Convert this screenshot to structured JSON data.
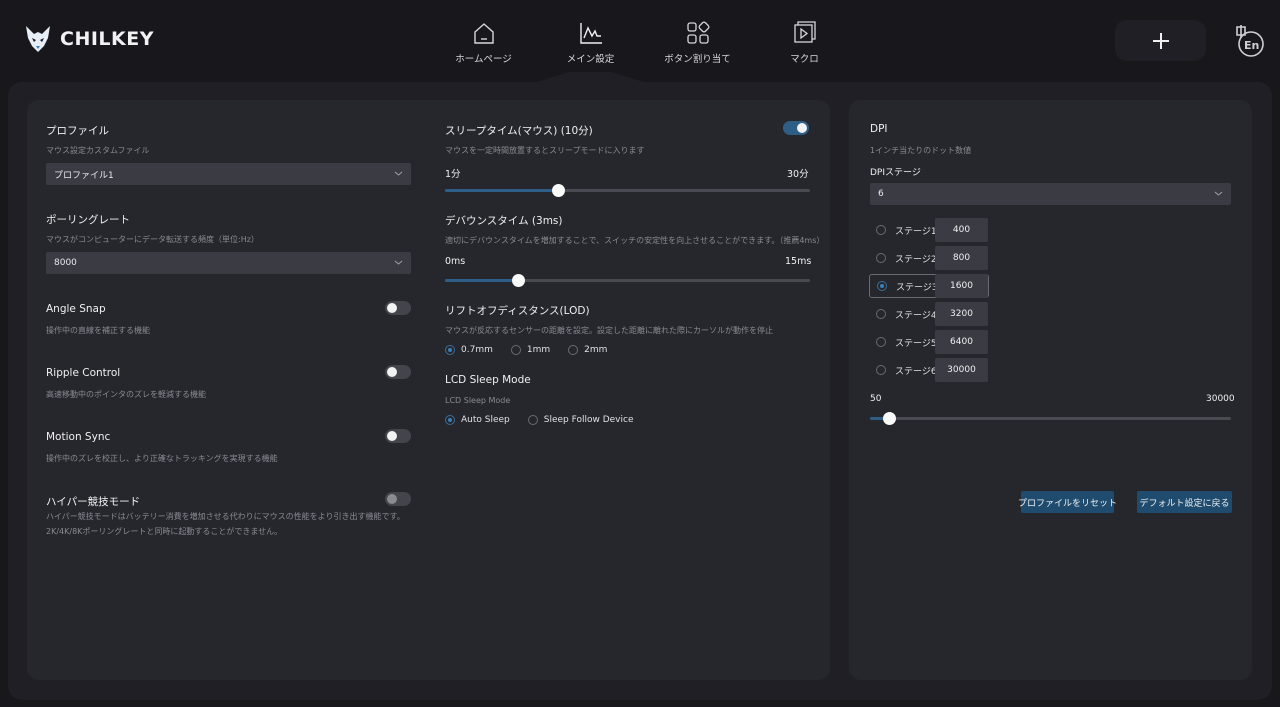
{
  "app": {
    "brand": "CHILKEY"
  },
  "nav": [
    {
      "label": "ホームページ",
      "icon": "home-icon"
    },
    {
      "label": "メイン設定",
      "icon": "chart-line-icon",
      "active": true
    },
    {
      "label": "ボタン割り当て",
      "icon": "grid-icon"
    },
    {
      "label": "マクロ",
      "icon": "macro-play-icon"
    }
  ],
  "header": {
    "add_icon": "plus-icon",
    "language_icon": "language-zh-en-icon"
  },
  "left": {
    "profile": {
      "title": "プロファイル",
      "subtitle": "マウス設定カスタムファイル",
      "value": "プロファイル1"
    },
    "polling": {
      "title": "ポーリングレート",
      "subtitle": "マウスがコンピューターにデータ転送する頻度（単位:Hz）",
      "value": "8000"
    },
    "angle_snap": {
      "title": "Angle Snap",
      "subtitle": "操作中の直線を補正する機能",
      "on": false
    },
    "ripple": {
      "title": "Ripple Control",
      "subtitle": "高速移動中のポインタのズレを軽減する機能",
      "on": false
    },
    "motion_sync": {
      "title": "Motion Sync",
      "subtitle": "操作中のズレを校正し、より正確なトラッキングを実現する機能",
      "on": false
    },
    "hyper": {
      "title": "ハイパー競技モード",
      "subtitle1": "ハイパー競技モードはバッテリー消費を増加させる代わりにマウスの性能をより引き出す機能です。",
      "subtitle2": "2K/4K/8Kポーリングレートと同時に起動することができません。",
      "on": false
    },
    "sleep": {
      "title": "スリープタイム(マウス) (10分)",
      "subtitle": "マウスを一定時間放置するとスリープモードに入ります",
      "min": "1分",
      "max": "30分",
      "on": true,
      "value": 10,
      "range": [
        1,
        30
      ]
    },
    "debounce": {
      "title": "デバウンスタイム (3ms)",
      "subtitle": "適切にデバウンスタイムを増加することで、スイッチの安定性を向上させることができます。（推薦4ms）",
      "min": "0ms",
      "max": "15ms",
      "value": 3,
      "range": [
        0,
        15
      ]
    },
    "lod": {
      "title": "リフトオフディスタンス(LOD)",
      "subtitle": "マウスが反応するセンサーの距離を設定。設定した距離に離れた際にカーソルが動作を停止",
      "options": [
        "0.7mm",
        "1mm",
        "2mm"
      ],
      "selected": 0
    },
    "lcd": {
      "title": "LCD Sleep Mode",
      "subtitle": "LCD Sleep Mode",
      "options": [
        "Auto Sleep",
        "Sleep Follow Device"
      ],
      "selected": 0
    }
  },
  "right": {
    "dpi": {
      "title": "DPI",
      "subtitle": "1インチ当たりのドット数値",
      "stage_label": "DPIステージ",
      "stage_value": "6"
    },
    "stages": [
      {
        "label": "ステージ1",
        "value": "400"
      },
      {
        "label": "ステージ2",
        "value": "800"
      },
      {
        "label": "ステージ3",
        "value": "1600"
      },
      {
        "label": "ステージ4",
        "value": "3200"
      },
      {
        "label": "ステージ5",
        "value": "6400"
      },
      {
        "label": "ステージ6",
        "value": "30000"
      }
    ],
    "active_stage": 2,
    "slider": {
      "min": "50",
      "max": "30000",
      "value": 1600
    },
    "buttons": {
      "reset_profile": "プロファイルをリセット",
      "restore_default": "デフォルト設定に戻る"
    }
  },
  "colors": {
    "accent": "#2e5e86",
    "panel": "#26262d",
    "background": "#17171c"
  }
}
